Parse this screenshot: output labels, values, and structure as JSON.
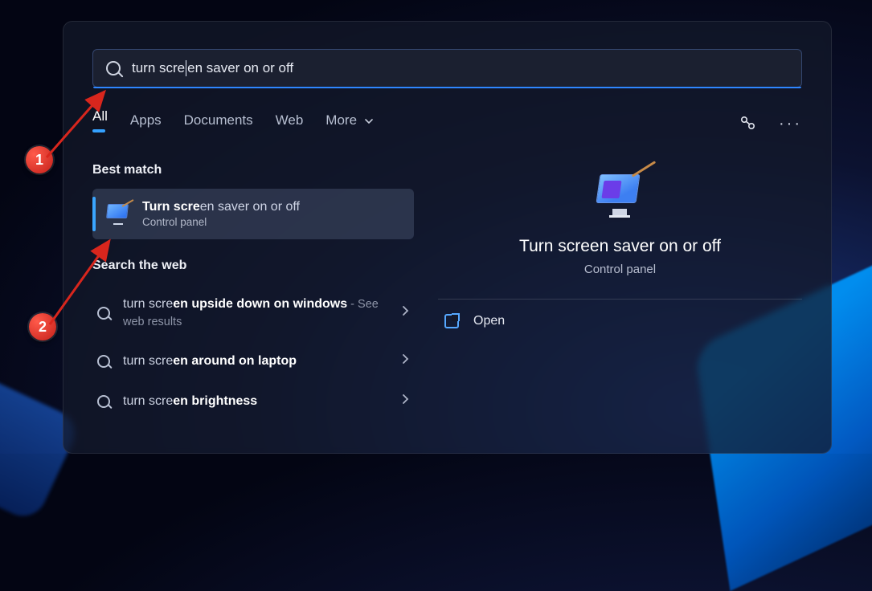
{
  "search": {
    "value_before_cursor": "turn scre",
    "value_after_cursor": "en saver on or off"
  },
  "tabs": {
    "items": [
      "All",
      "Apps",
      "Documents",
      "Web",
      "More"
    ],
    "active_index": 0
  },
  "sections": {
    "best_match_heading": "Best match",
    "search_web_heading": "Search the web"
  },
  "best_match": {
    "title_prefix": "Turn scre",
    "title_rest": "en saver on or off",
    "subtitle": "Control panel"
  },
  "web_results": [
    {
      "prefix": "turn scre",
      "bold": "en upside down on windows",
      "extra": " - See web results"
    },
    {
      "prefix": "turn scre",
      "bold": "en around on laptop",
      "extra": ""
    },
    {
      "prefix": "turn scre",
      "bold": "en brightness",
      "extra": ""
    }
  ],
  "preview": {
    "title": "Turn screen saver on or off",
    "subtitle": "Control panel",
    "open_label": "Open"
  },
  "annotations": {
    "n1": "1",
    "n2": "2"
  }
}
